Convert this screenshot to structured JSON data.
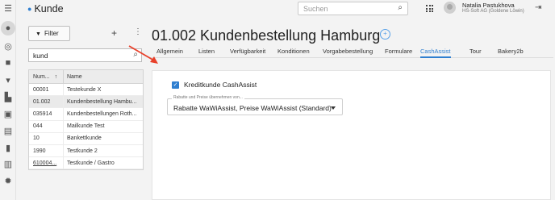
{
  "rail": {
    "icons": [
      "menu-icon",
      "person-icon",
      "contacts-icon",
      "briefcase-icon",
      "cart-icon",
      "factory-icon",
      "cash-icon",
      "document-icon",
      "building-icon",
      "chart-icon",
      "settings-icon"
    ]
  },
  "header": {
    "app_title": "Kunde",
    "search_placeholder": "Suchen",
    "user_name": "Natalia Pastukhova",
    "user_org": "HS-Soft AG (Goldene Löwin)"
  },
  "list": {
    "filter_label": "Filter",
    "search_value": "kund",
    "columns": [
      "Num...",
      "Name"
    ],
    "rows": [
      {
        "num": "00001",
        "name": "Testekunde X"
      },
      {
        "num": "01.002",
        "name": "Kundenbestellung Hambu..."
      },
      {
        "num": "035914",
        "name": "Kundenbestellungen Roth..."
      },
      {
        "num": "044",
        "name": "Mailkunde Test"
      },
      {
        "num": "10",
        "name": "Bankettkunde"
      },
      {
        "num": "1990",
        "name": "Testkunde 2"
      },
      {
        "num": "610004...",
        "name": "Testkunde / Gastro"
      }
    ]
  },
  "main": {
    "title": "01.002 Kundenbestellung Hamburg",
    "tabs": [
      "Allgemein",
      "Listen",
      "Verfügbarkeit",
      "Konditionen",
      "Vorgabebestellung",
      "Formulare",
      "CashAssist",
      "Tour",
      "Bakery2b"
    ],
    "active_tab": "CashAssist",
    "checkbox_label": "Kreditkunde CashAssist",
    "checkbox_checked": true,
    "select_legend": "Rabatte und Preise übernehmen von...",
    "select_value": "Rabatte WaWiAssist, Preise WaWiAssist (Standard)"
  },
  "colors": {
    "accent": "#2f7fd0",
    "annotation_arrow": "#e8402a"
  }
}
